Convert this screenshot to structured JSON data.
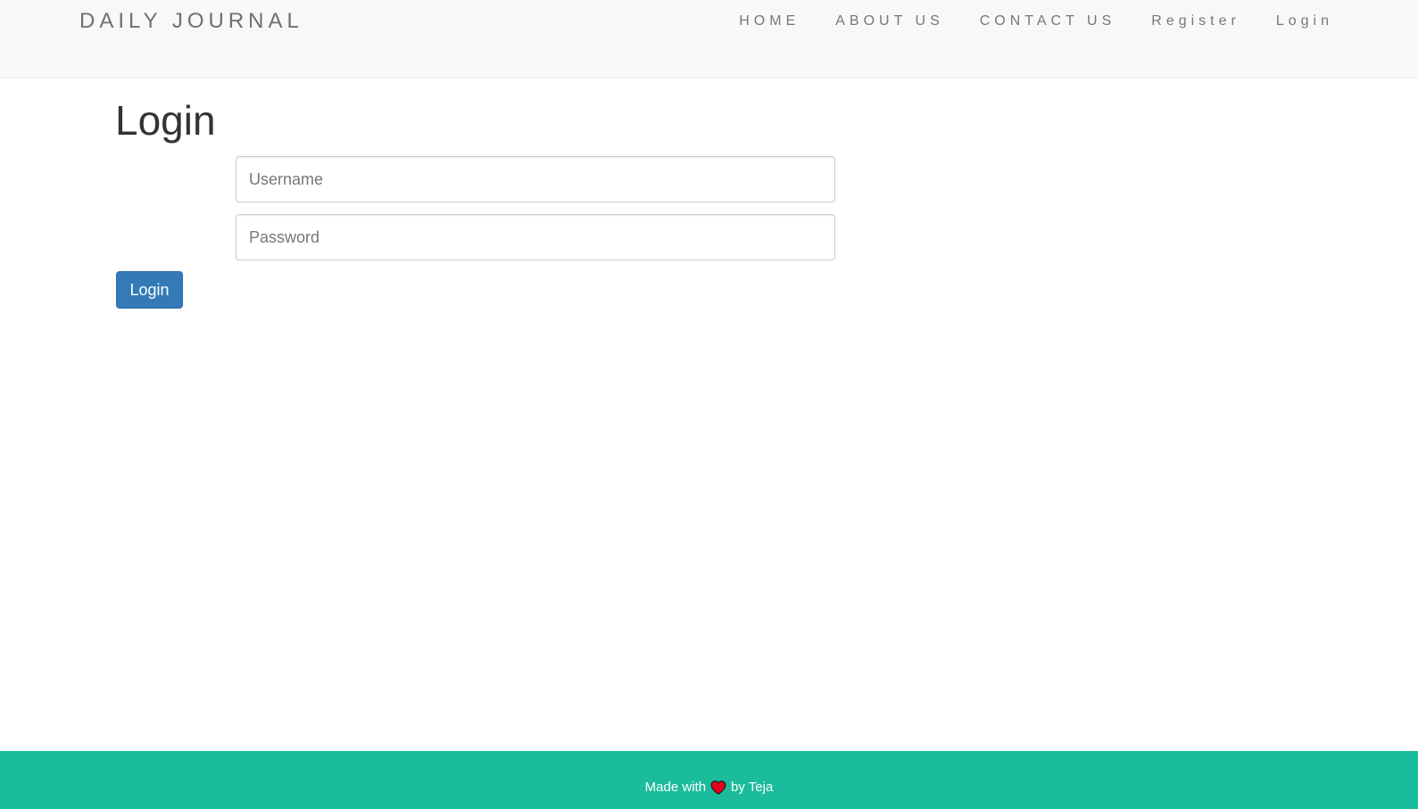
{
  "navbar": {
    "brand": "DAILY JOURNAL",
    "links": [
      {
        "label": "HOME"
      },
      {
        "label": "ABOUT US"
      },
      {
        "label": "CONTACT US"
      },
      {
        "label": "Register"
      },
      {
        "label": "Login"
      }
    ]
  },
  "main": {
    "title": "Login",
    "username_placeholder": "Username",
    "password_placeholder": "Password",
    "username_value": "",
    "password_value": "",
    "submit_label": "Login"
  },
  "footer": {
    "prefix": "Made with",
    "suffix": "by Teja",
    "heart_icon": "heart-icon"
  },
  "colors": {
    "navbar_bg": "#f8f8f8",
    "primary": "#337ab7",
    "footer_bg": "#1abc9c",
    "heart": "#e3001b"
  }
}
